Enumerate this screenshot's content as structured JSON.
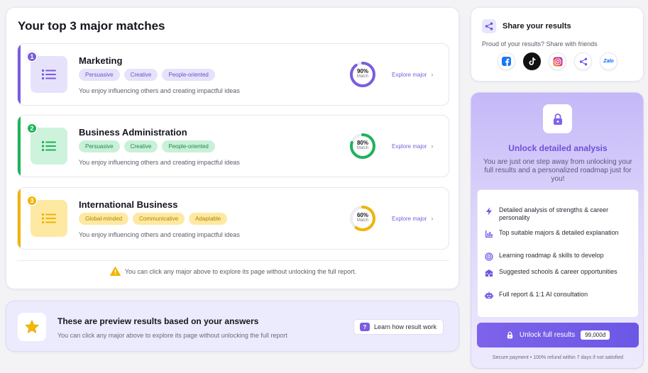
{
  "matches": {
    "title": "Your top 3 major matches",
    "items": [
      {
        "rank": "1",
        "name": "Marketing",
        "tags": [
          "Persuasive",
          "Creative",
          "People-oriented"
        ],
        "description": "You enjoy influencing others and creating impactful ideas",
        "match_percent": 90,
        "match_label": "Match",
        "explore_label": "Explore major",
        "accent_color": "#7c5ce0",
        "tile_color": "#e6e2fb",
        "tag_bg": "#e6e2fb",
        "tag_color": "#6b51c9"
      },
      {
        "rank": "2",
        "name": "Business Administration",
        "tags": [
          "Persuasive",
          "Creative",
          "People-oriented"
        ],
        "description": "You enjoy influencing others and creating impactful ideas",
        "match_percent": 80,
        "match_label": "Match",
        "explore_label": "Explore major",
        "accent_color": "#1fb35a",
        "tile_color": "#cdf3dc",
        "tag_bg": "#c9f0d8",
        "tag_color": "#1e8a48"
      },
      {
        "rank": "3",
        "name": "International Business",
        "tags": [
          "Global-minded",
          "Communicative",
          "Adaptable"
        ],
        "description": "You enjoy influencing others and creating impactful ideas",
        "match_percent": 60,
        "match_label": "Match",
        "explore_label": "Explore major",
        "accent_color": "#f0b400",
        "tile_color": "#fde9a2",
        "tag_bg": "#fde9a2",
        "tag_color": "#b38300"
      }
    ],
    "notice": "You can click any major above to explore its page without unlocking the full report."
  },
  "preview": {
    "title": "These are preview results based on your answers",
    "subtitle": "You can click any major above to explore its page without unlocking the full report",
    "button_label": "Learn how result work"
  },
  "share": {
    "title": "Share your results",
    "subtitle": "Proud of your results? Share with friends",
    "networks": [
      "facebook-icon",
      "tiktok-icon",
      "instagram-icon",
      "share-link-icon",
      "zalo-icon"
    ],
    "zalo_label": "Zalo"
  },
  "unlock": {
    "title": "Unlock detailed analysis",
    "subtitle": "You are just one step away from unlocking your full results and a personalized roadmap just for you!",
    "features": [
      {
        "icon": "bolt-icon",
        "text": "Detailed analysis of strengths & career personality"
      },
      {
        "icon": "bar-chart-icon",
        "text": "Top suitable majors & detailed explanation"
      },
      {
        "icon": "target-icon",
        "text": "Learning roadmap & skills to develop"
      },
      {
        "icon": "school-icon",
        "text": "Suggested schools & career opportunities"
      },
      {
        "icon": "robot-icon",
        "text": "Full report & 1:1 AI consultation"
      }
    ],
    "button_label": "Unlock full results",
    "price": "99,000đ",
    "secure_note": "Secure payment • 100% refund within 7 days if not satisfied"
  },
  "colors": {
    "brand": "#7c5ce0",
    "brand_dark": "#6e4fd8",
    "warning": "#f0b400"
  }
}
